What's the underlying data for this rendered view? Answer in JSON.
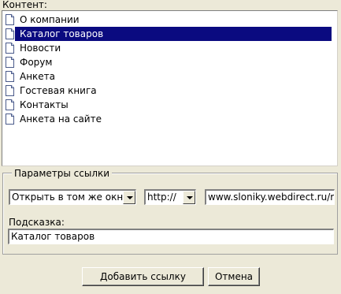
{
  "content_label": "Контент:",
  "list": {
    "items": [
      {
        "label": "О компании",
        "icon": "document-icon",
        "selected": false
      },
      {
        "label": "Каталог товаров",
        "icon": "document-icon",
        "selected": true
      },
      {
        "label": "Новости",
        "icon": "document-icon",
        "selected": false
      },
      {
        "label": "Форум",
        "icon": "document-icon",
        "selected": false
      },
      {
        "label": "Анкета",
        "icon": "document-icon",
        "selected": false
      },
      {
        "label": "Гостевая книга",
        "icon": "document-icon",
        "selected": false
      },
      {
        "label": "Контакты",
        "icon": "document-icon",
        "selected": false
      },
      {
        "label": "Анкета на сайте",
        "icon": "document-icon",
        "selected": false
      }
    ]
  },
  "link_params": {
    "legend": "Параметры ссылки",
    "target_select": {
      "value": "Открыть в том же окне"
    },
    "protocol_select": {
      "value": "http://"
    },
    "url_value": "www.sloniky.webdirect.ru/ru",
    "hint_label": "Подсказка:",
    "hint_value": "Каталог товаров"
  },
  "buttons": {
    "add_link": "Добавить ссылку",
    "cancel": "Отмена"
  },
  "colors": {
    "background": "#ece9d8",
    "selection": "#0a0a80",
    "selection_text": "#ffffff"
  }
}
